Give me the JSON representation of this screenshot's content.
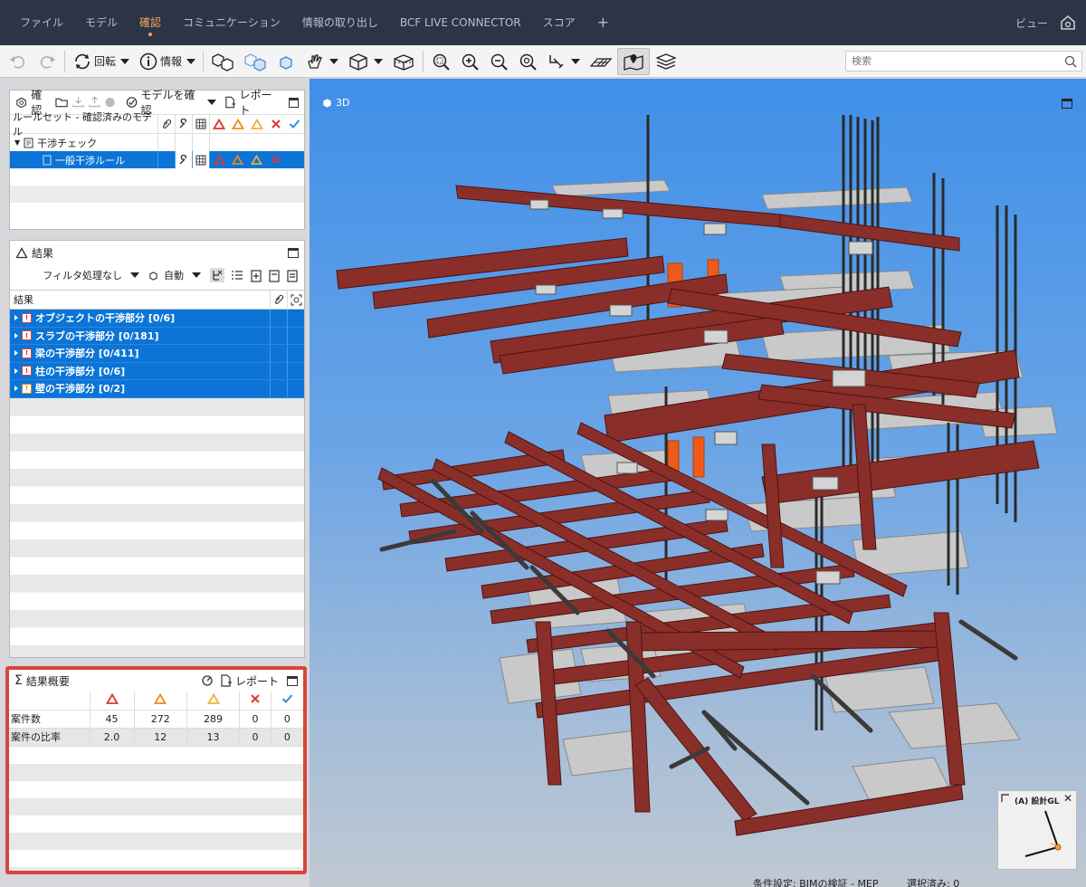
{
  "menubar": {
    "items": [
      "ファイル",
      "モデル",
      "確認",
      "コミュニケーション",
      "情報の取り出し",
      "BCF LIVE CONNECTOR",
      "スコア"
    ],
    "add_label": "+",
    "view_label": "ビュー"
  },
  "toolbar": {
    "rotate_label": "回転",
    "info_label": "情報",
    "search_placeholder": "検索"
  },
  "check_panel": {
    "title": "確認",
    "check_model_label": "モデルを確認",
    "report_label": "レポート",
    "header_label": "ルールセット - 確認済みのモデル",
    "ruleset_label": "干渉チェック",
    "rule_label": "一般干渉ルール"
  },
  "results_panel": {
    "title": "結果",
    "filter_label": "フィルタ処理なし",
    "auto_label": "自動",
    "column_label": "結果",
    "rows": [
      {
        "label": "オブジェクトの干渉部分 [0/6]"
      },
      {
        "label": "スラブの干渉部分 [0/181]"
      },
      {
        "label": "梁の干渉部分 [0/411]"
      },
      {
        "label": "柱の干渉部分 [0/6]"
      },
      {
        "label": "壁の干渉部分 [0/2]"
      }
    ]
  },
  "summary_panel": {
    "title": "結果概要",
    "report_label": "レポート",
    "rows": [
      {
        "label": "案件数",
        "values": [
          "45",
          "272",
          "289",
          "0",
          "0"
        ]
      },
      {
        "label": "案件の比率",
        "values": [
          "2.0",
          "12",
          "13",
          "0",
          "0"
        ]
      }
    ]
  },
  "viewport": {
    "label": "3D",
    "nav_cube_label": "(A) 設計GL",
    "status_left": "条件設定: BIMの検証 - MEP",
    "status_right": "選択済み: 0"
  },
  "colors": {
    "menubar": "#2c3445",
    "accent": "#f5a46a",
    "selection": "#0b74d6",
    "critical": "#e0362c",
    "major": "#f28a1e",
    "normal": "#f2b233",
    "steel": "#8a2e2a"
  }
}
